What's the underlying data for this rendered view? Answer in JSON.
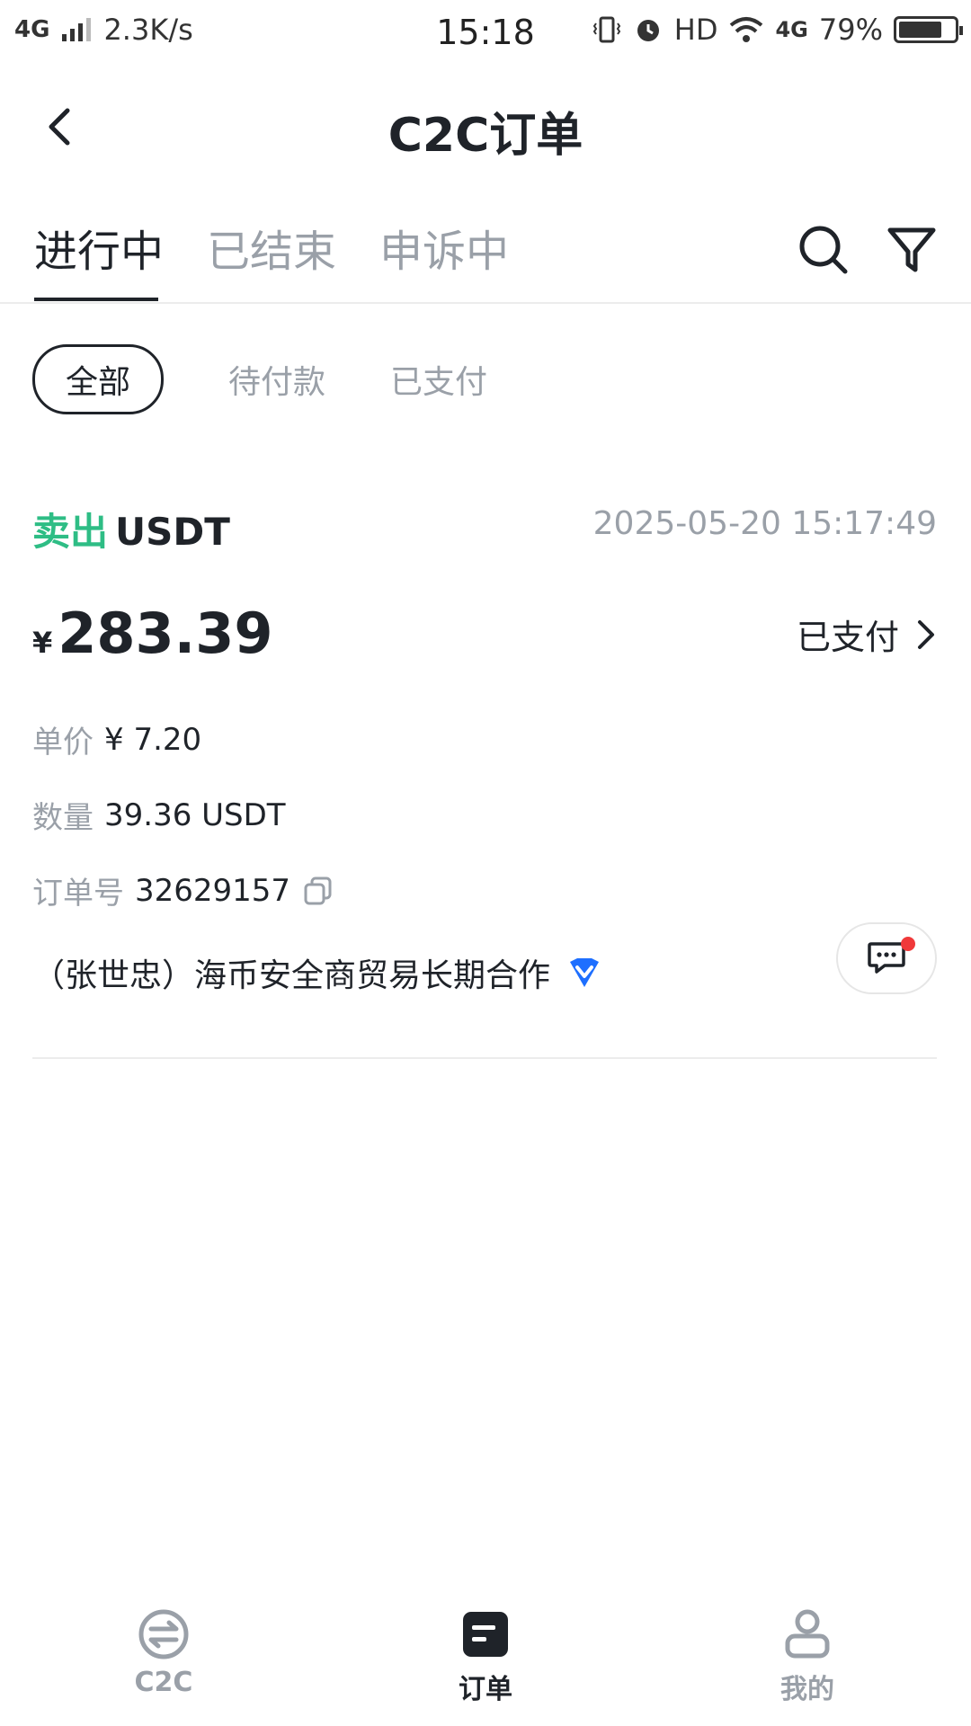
{
  "status_bar": {
    "network": "4G",
    "speed": "2.3K/s",
    "time": "15:18",
    "hd": "HD",
    "network_right": "4G",
    "battery": "79%",
    "battery_level": 0.79
  },
  "nav": {
    "title": "C2C订单"
  },
  "tabs": [
    {
      "label": "进行中",
      "active": true
    },
    {
      "label": "已结束",
      "active": false
    },
    {
      "label": "申诉中",
      "active": false
    }
  ],
  "chips": [
    {
      "label": "全部",
      "active": true
    },
    {
      "label": "待付款",
      "active": false
    },
    {
      "label": "已支付",
      "active": false
    }
  ],
  "order": {
    "side": "卖出",
    "coin": "USDT",
    "time": "2025-05-20 15:17:49",
    "currency_symbol": "¥",
    "amount": "283.39",
    "status": "已支付",
    "price_label": "单价",
    "price_value": "¥ 7.20",
    "qty_label": "数量",
    "qty_value": "39.36 USDT",
    "order_no_label": "订单号",
    "order_no_value": "32629157",
    "merchant": "（张世忠）海币安全商贸易长期合作"
  },
  "bottom_nav": [
    {
      "label": "C2C",
      "icon": "exchange-icon",
      "active": false
    },
    {
      "label": "订单",
      "icon": "order-icon",
      "active": true
    },
    {
      "label": "我的",
      "icon": "user-icon",
      "active": false
    }
  ],
  "colors": {
    "sell": "#2ebd85",
    "text": "#1f2329",
    "muted": "#9aa0a8",
    "badge_dot": "#f0393a",
    "verified": "#1e6fff"
  }
}
